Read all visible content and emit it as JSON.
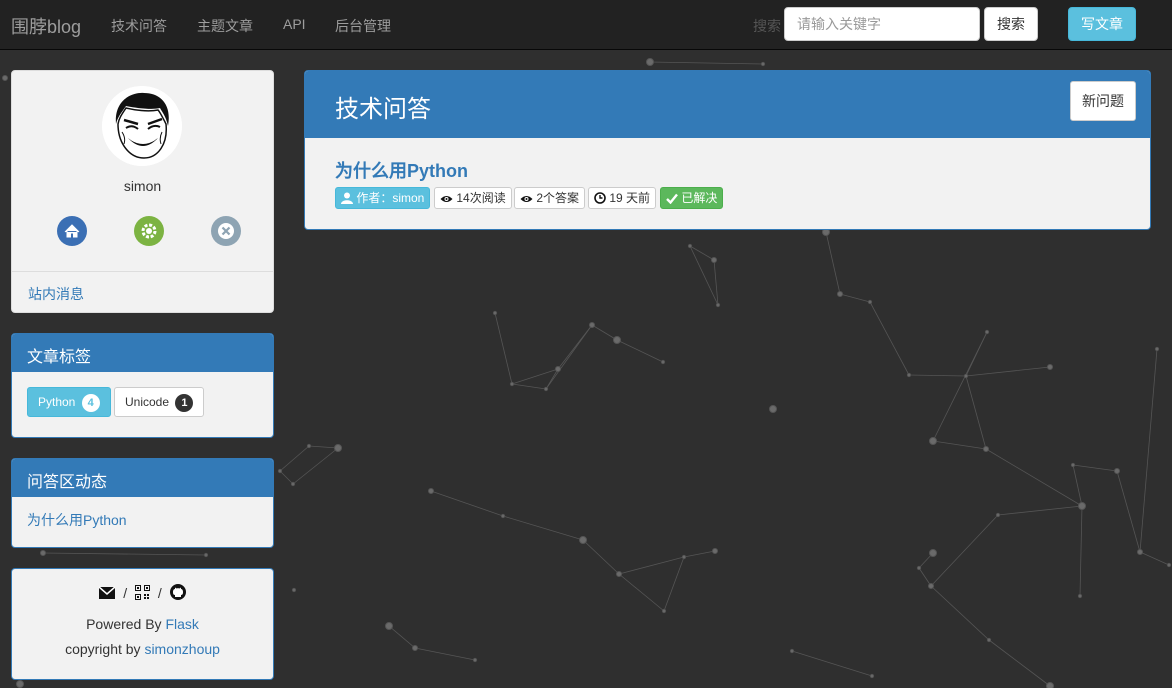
{
  "navbar": {
    "brand": "围脖blog",
    "links": [
      "技术问答",
      "主题文章",
      "API",
      "后台管理"
    ],
    "search_label": "搜索",
    "search_placeholder": "请输入关键字",
    "search_button": "搜索",
    "write_button": "写文章"
  },
  "profile": {
    "username": "simon",
    "icons": [
      "home-icon",
      "settings-icon",
      "logout-icon"
    ],
    "messages_link": "站内消息"
  },
  "tags_panel": {
    "title": "文章标签",
    "tags": [
      {
        "name": "Python",
        "count": "4"
      },
      {
        "name": "Unicode",
        "count": "1"
      }
    ]
  },
  "activity_panel": {
    "title": "问答区动态",
    "items": [
      "为什么用Python"
    ]
  },
  "footer_panel": {
    "icons": [
      "mail-icon",
      "qrcode-icon",
      "github-icon"
    ],
    "separator": "/",
    "powered_prefix": "Powered By",
    "powered_link": "Flask",
    "copyright_prefix": "copyright by",
    "copyright_link": "simonzhoup"
  },
  "main": {
    "title": "技术问答",
    "new_question_button": "新问题",
    "question": {
      "title": "为什么用Python",
      "author_label": "作者：simon",
      "reads": "14次阅读",
      "answers": "2个答案",
      "time": "19 天前",
      "status": "已解决"
    }
  },
  "colors": {
    "navbar_bg": "#222222",
    "primary": "#337ab7",
    "info": "#5bc0de",
    "success": "#5cb85c",
    "page_bg": "#2f2f2f"
  }
}
